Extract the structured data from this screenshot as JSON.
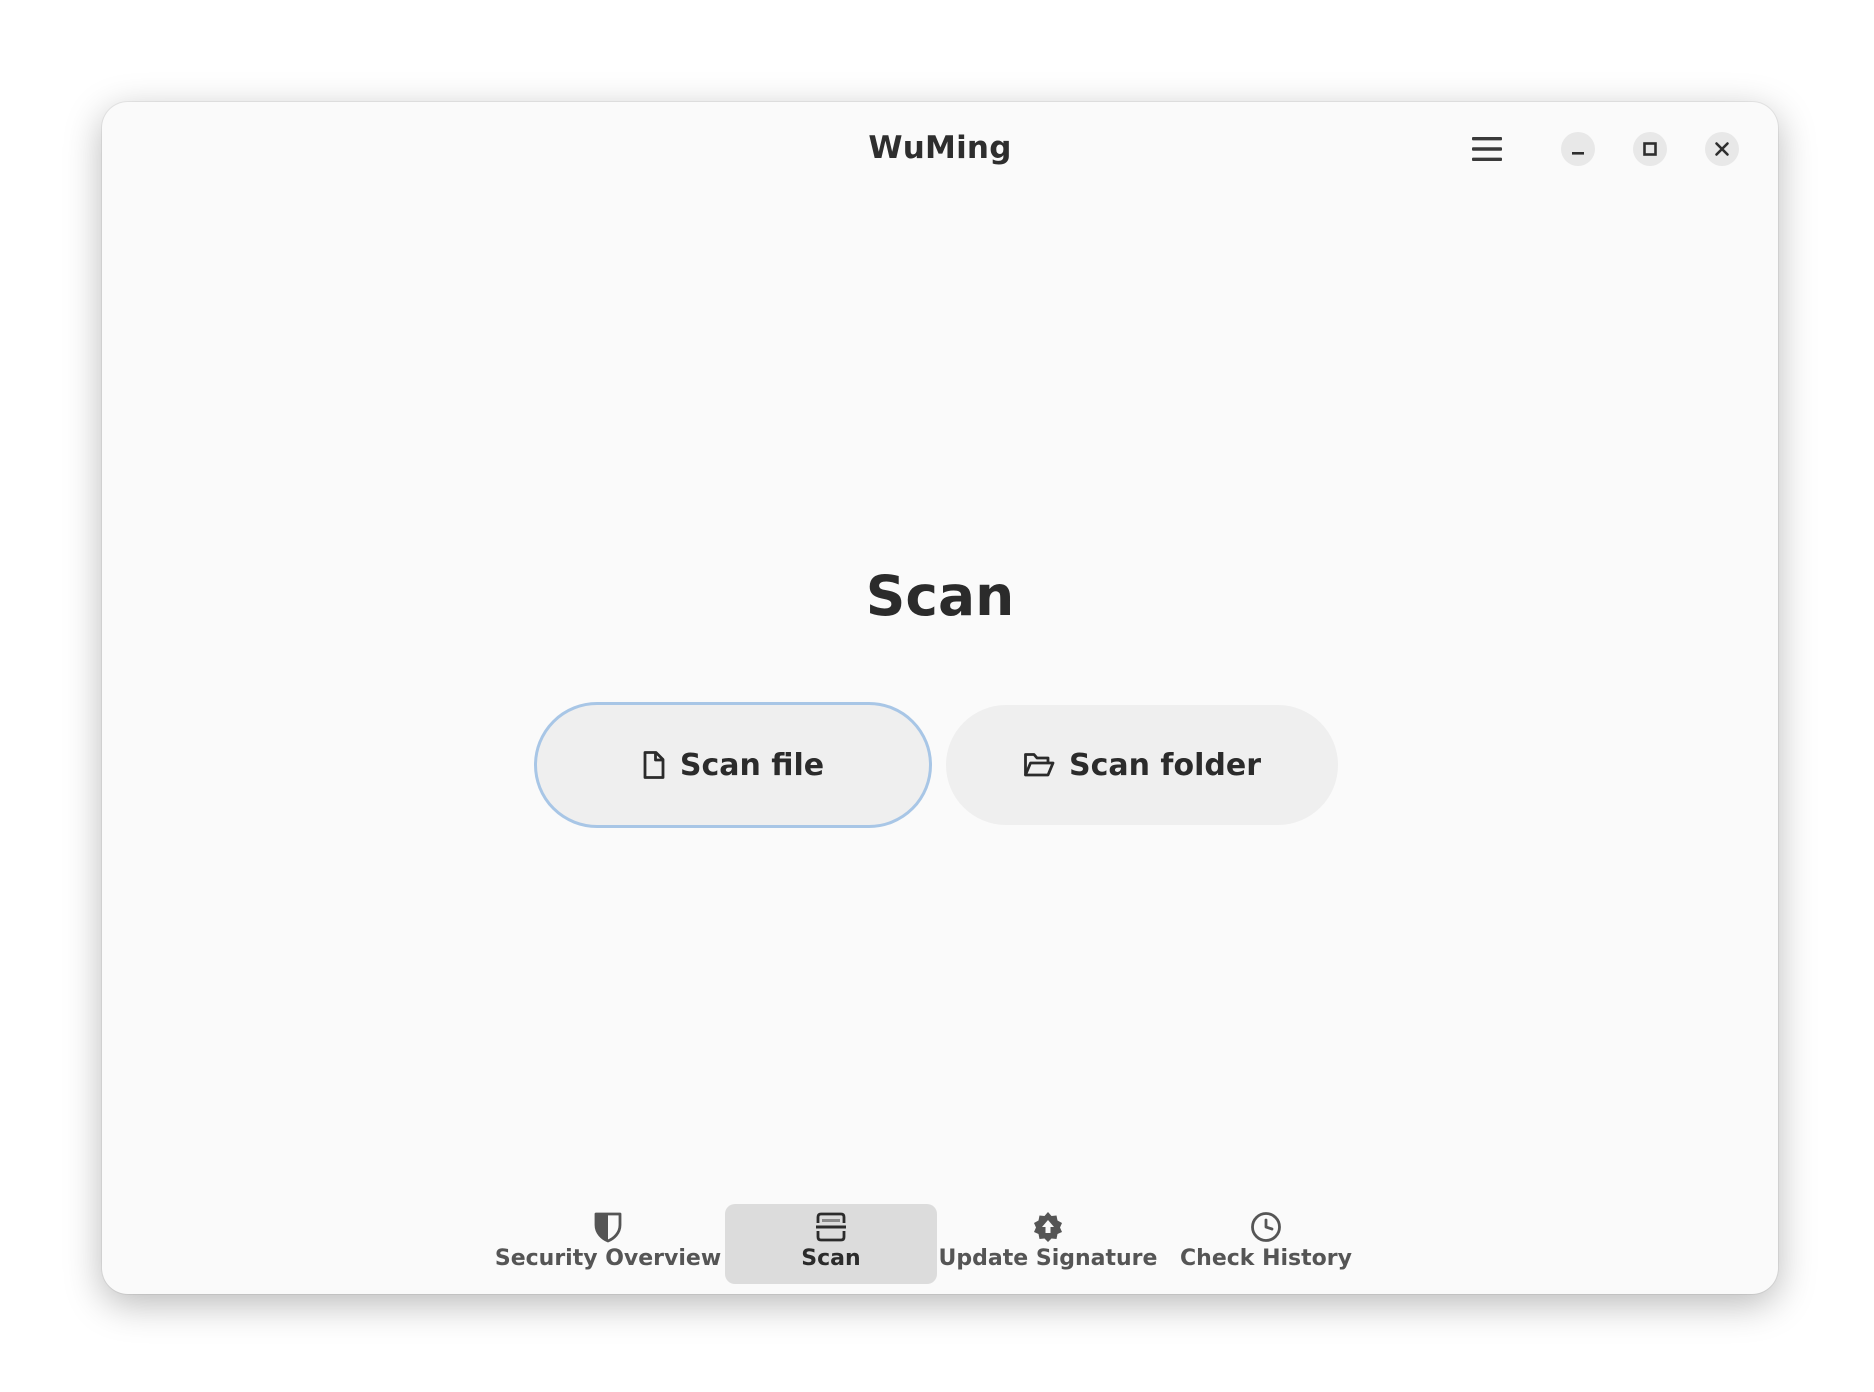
{
  "window": {
    "title": "WuMing"
  },
  "titlebar": {
    "menu_icon": "hamburger-menu-icon",
    "controls": {
      "minimize_icon": "minimize-icon",
      "maximize_icon": "maximize-icon",
      "close_icon": "close-icon"
    }
  },
  "main": {
    "heading": "Scan",
    "actions": {
      "scan_file": {
        "label": "Scan file",
        "icon": "file-icon",
        "focused": true
      },
      "scan_folder": {
        "label": "Scan folder",
        "icon": "folder-open-icon"
      }
    }
  },
  "bottom_nav": {
    "items": [
      {
        "label": "Security Overview",
        "icon": "shield-icon",
        "active": false
      },
      {
        "label": "Scan",
        "icon": "scanner-icon",
        "active": true
      },
      {
        "label": "Update Signature",
        "icon": "gear-upload-icon",
        "active": false
      },
      {
        "label": "Check History",
        "icon": "clock-icon",
        "active": false
      }
    ]
  },
  "colors": {
    "window_bg": "#fafafa",
    "button_bg": "#efefef",
    "focus_ring": "#a8c6e6",
    "active_tab_bg": "#dcdcdc",
    "text": "#2b2b2b"
  }
}
